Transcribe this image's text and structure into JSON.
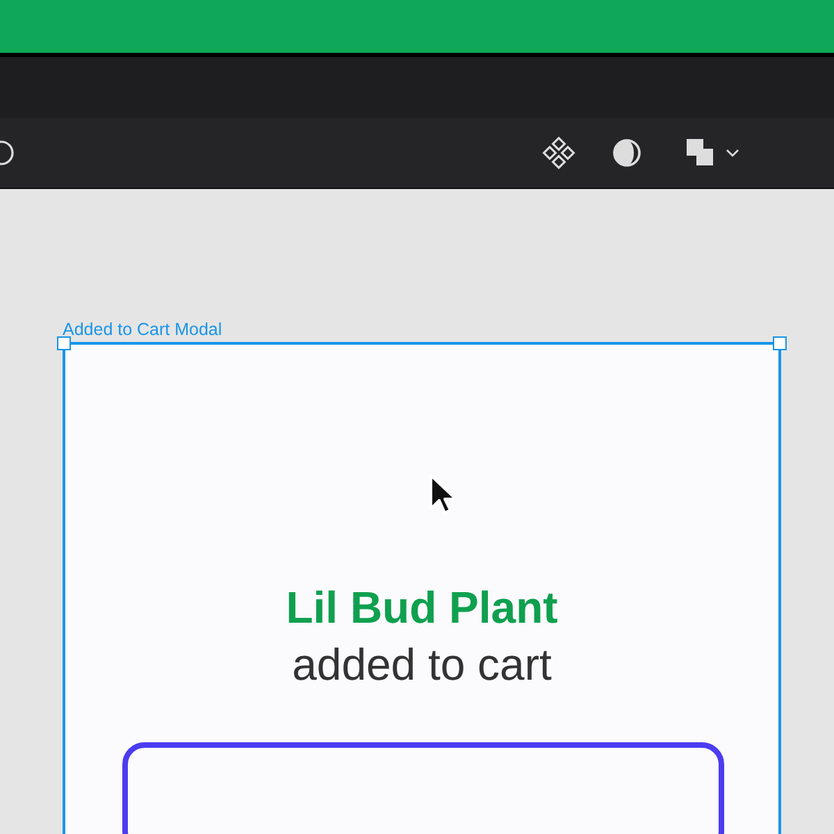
{
  "frame": {
    "label": "Added to Cart Modal",
    "selected": true
  },
  "modal": {
    "title": "Lil Bud Plant",
    "subtitle": "added to cart"
  }
}
